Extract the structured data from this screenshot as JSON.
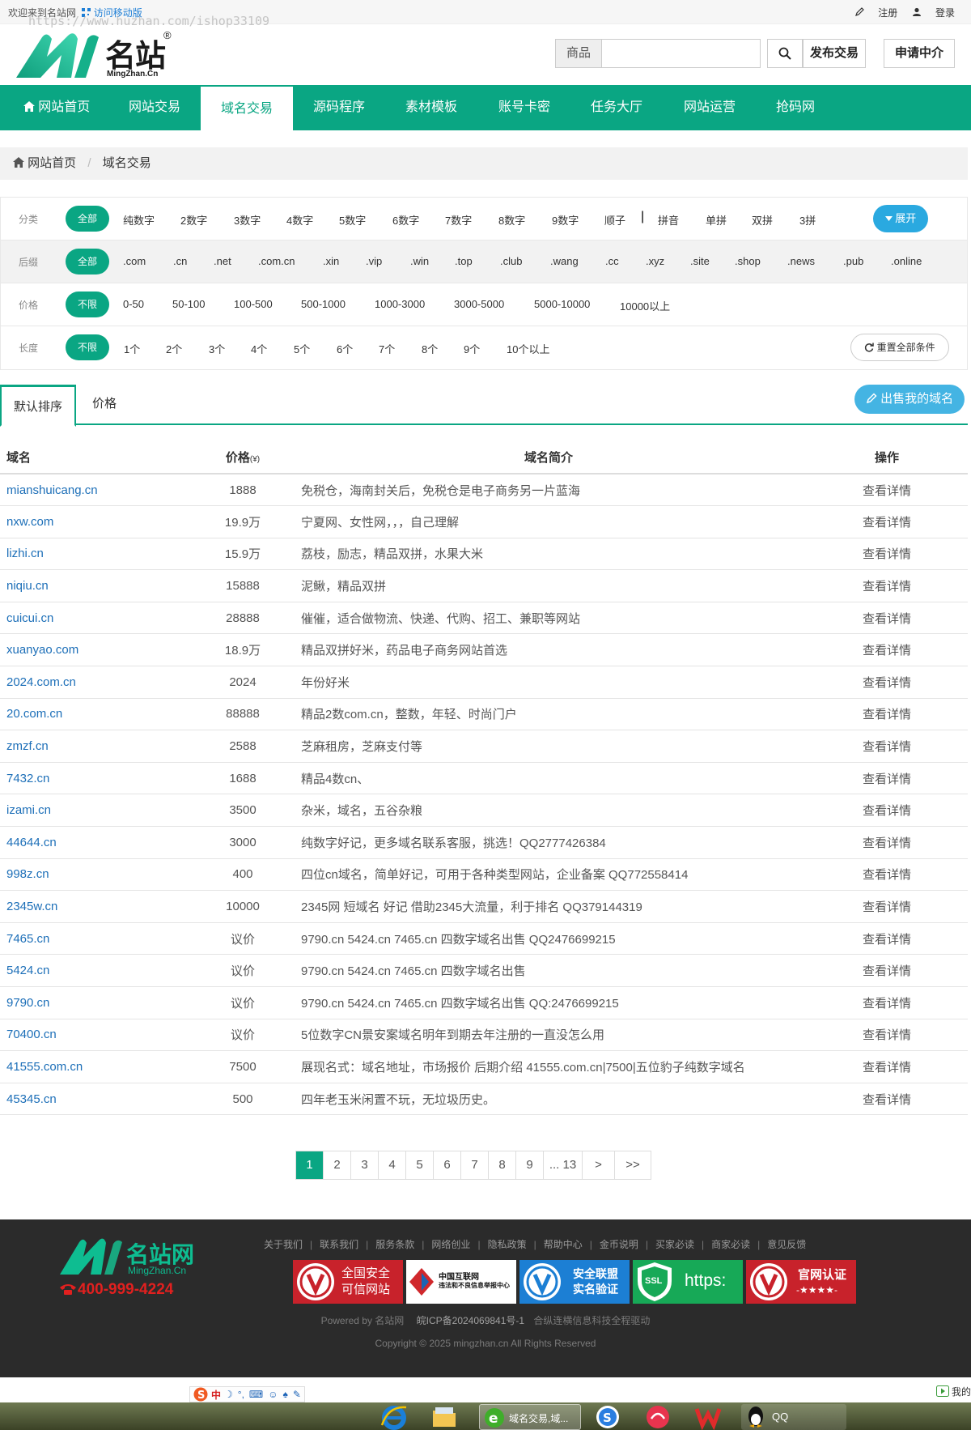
{
  "topbar": {
    "welcome": "欢迎来到名站网",
    "mobile": "访问移动版",
    "watermark": "https://www.huzhan.com/ishop33109",
    "register": "注册",
    "login": "登录"
  },
  "header": {
    "logo_cn": "名站",
    "logo_reg": "®",
    "logo_en": "MingZhan.Cn",
    "search_category": "商品",
    "search_placeholder": "",
    "publish_button": "发布交易",
    "agent_button": "申请中介"
  },
  "nav": {
    "items": [
      {
        "label": "网站首页"
      },
      {
        "label": "网站交易"
      },
      {
        "label": "域名交易"
      },
      {
        "label": "源码程序"
      },
      {
        "label": "素材模板"
      },
      {
        "label": "账号卡密"
      },
      {
        "label": "任务大厅"
      },
      {
        "label": "网站运营"
      },
      {
        "label": "抢码网"
      }
    ],
    "active_index": 2
  },
  "breadcrumb": {
    "home": "网站首页",
    "current": "域名交易"
  },
  "filters": {
    "category": {
      "label": "分类",
      "selected": "全部",
      "options": [
        "纯数字",
        "2数字",
        "3数字",
        "4数字",
        "5数字",
        "6数字",
        "7数字",
        "8数字",
        "9数字",
        "顺子",
        "|",
        "拼音",
        "单拼",
        "双拼",
        "3拼"
      ],
      "expand": "展开"
    },
    "suffix": {
      "label": "后缀",
      "selected": "全部",
      "options": [
        ".com",
        ".cn",
        ".net",
        ".com.cn",
        ".xin",
        ".vip",
        ".win",
        ".top",
        ".club",
        ".wang",
        ".cc",
        ".xyz",
        ".site",
        ".shop",
        ".news",
        ".pub",
        ".online"
      ]
    },
    "price": {
      "label": "价格",
      "selected": "不限",
      "options": [
        "0-50",
        "50-100",
        "100-500",
        "500-1000",
        "1000-3000",
        "3000-5000",
        "5000-10000",
        "10000以上"
      ]
    },
    "length": {
      "label": "长度",
      "selected": "不限",
      "options": [
        "1个",
        "2个",
        "3个",
        "4个",
        "5个",
        "6个",
        "7个",
        "8个",
        "9个",
        "10个以上"
      ],
      "reset": "重置全部条件"
    }
  },
  "sort": {
    "tabs": [
      "默认排序",
      "价格"
    ],
    "active_index": 0,
    "sell_button": "出售我的域名"
  },
  "table": {
    "headers": {
      "domain": "域名",
      "price": "价格",
      "price_unit": "(¥)",
      "desc": "域名简介",
      "action": "操作"
    },
    "rows": [
      {
        "domain": "mianshuicang.cn",
        "price": "1888",
        "desc": "免税仓，海南封关后，免税仓是电子商务另一片蓝海",
        "action": "查看详情"
      },
      {
        "domain": "nxw.com",
        "price": "19.9万",
        "desc": "宁夏网、女性网，，，自己理解",
        "action": "查看详情"
      },
      {
        "domain": "lizhi.cn",
        "price": "15.9万",
        "desc": "荔枝，励志，精品双拼，水果大米",
        "action": "查看详情"
      },
      {
        "domain": "niqiu.cn",
        "price": "15888",
        "desc": "泥鳅，精品双拼",
        "action": "查看详情"
      },
      {
        "domain": "cuicui.cn",
        "price": "28888",
        "desc": "催催，适合做物流、快递、代购、招工、兼职等网站",
        "action": "查看详情"
      },
      {
        "domain": "xuanyao.com",
        "price": "18.9万",
        "desc": "精品双拼好米，药品电子商务网站首选",
        "action": "查看详情"
      },
      {
        "domain": "2024.com.cn",
        "price": "2024",
        "desc": "年份好米",
        "action": "查看详情"
      },
      {
        "domain": "20.com.cn",
        "price": "88888",
        "desc": "精品2数com.cn，整数，年轻、时尚门户",
        "action": "查看详情"
      },
      {
        "domain": "zmzf.cn",
        "price": "2588",
        "desc": "芝麻租房，芝麻支付等",
        "action": "查看详情"
      },
      {
        "domain": "7432.cn",
        "price": "1688",
        "desc": "精品4数cn、",
        "action": "查看详情"
      },
      {
        "domain": "izami.cn",
        "price": "3500",
        "desc": "杂米，域名，五谷杂粮",
        "action": "查看详情"
      },
      {
        "domain": "44644.cn",
        "price": "3000",
        "desc": "纯数字好记，更多域名联系客服，挑选！QQ2777426384",
        "action": "查看详情"
      },
      {
        "domain": "998z.cn",
        "price": "400",
        "desc": "四位cn域名，简单好记，可用于各种类型网站，企业备案 QQ772558414",
        "action": "查看详情"
      },
      {
        "domain": "2345w.cn",
        "price": "10000",
        "desc": "2345网 短域名 好记 借助2345大流量，利于排名 QQ379144319",
        "action": "查看详情"
      },
      {
        "domain": "7465.cn",
        "price": "议价",
        "desc": "9790.cn 5424.cn 7465.cn 四数字域名出售 QQ2476699215",
        "action": "查看详情"
      },
      {
        "domain": "5424.cn",
        "price": "议价",
        "desc": "9790.cn 5424.cn 7465.cn 四数字域名出售",
        "action": "查看详情"
      },
      {
        "domain": "9790.cn",
        "price": "议价",
        "desc": "9790.cn 5424.cn 7465.cn 四数字域名出售 QQ:2476699215",
        "action": "查看详情"
      },
      {
        "domain": "70400.cn",
        "price": "议价",
        "desc": "5位数字CN景安案域名明年到期去年注册的一直没怎么用",
        "action": "查看详情"
      },
      {
        "domain": "41555.com.cn",
        "price": "7500",
        "desc": "展现名式：域名地址，市场报价 后期介绍 41555.com.cn|7500|五位豹子纯数字域名",
        "action": "查看详情"
      },
      {
        "domain": "45345.cn",
        "price": "500",
        "desc": "四年老玉米闲置不玩，无垃圾历史。",
        "action": "查看详情"
      }
    ]
  },
  "pagination": {
    "pages": [
      "1",
      "2",
      "3",
      "4",
      "5",
      "6",
      "7",
      "8",
      "9",
      "... 13",
      ">",
      ">>"
    ],
    "current": "1"
  },
  "footer": {
    "logo_cn": "名站网",
    "logo_en": "MingZhan.Cn",
    "phone": "400-999-4224",
    "links": [
      "关于我们",
      "联系我们",
      "服务条款",
      "网络创业",
      "隐私政策",
      "帮助中心",
      "金币说明",
      "买家必读",
      "商家必读",
      "意见反馈"
    ],
    "badges": {
      "b1": "全国安全\n可信网站",
      "b2_title": "中国互联网",
      "b2_sub": "违法和不良信息举报中心",
      "b3": "安全联盟\n实名验证",
      "b4_ssl": "SSL",
      "b4_text": "https:",
      "b5_title": "官网认证",
      "b5_stars": "-★★★★-"
    },
    "powered": "Powered by 名站网",
    "icp": "皖ICP备2024069841号-1",
    "driver": "合纵连横信息科技全程驱动",
    "copyright": "Copyright © 2025 mingzhan.cn All Rights Reserved"
  },
  "system": {
    "ime_label": "中",
    "tray_label": "我的",
    "task_title": "域名交易,域...",
    "qq_label": "QQ"
  },
  "colors": {
    "brand": "#0aa683",
    "link": "#1d6fb8",
    "accent_blue": "#2aa9e0",
    "footer_bg": "#2b2b2b"
  }
}
